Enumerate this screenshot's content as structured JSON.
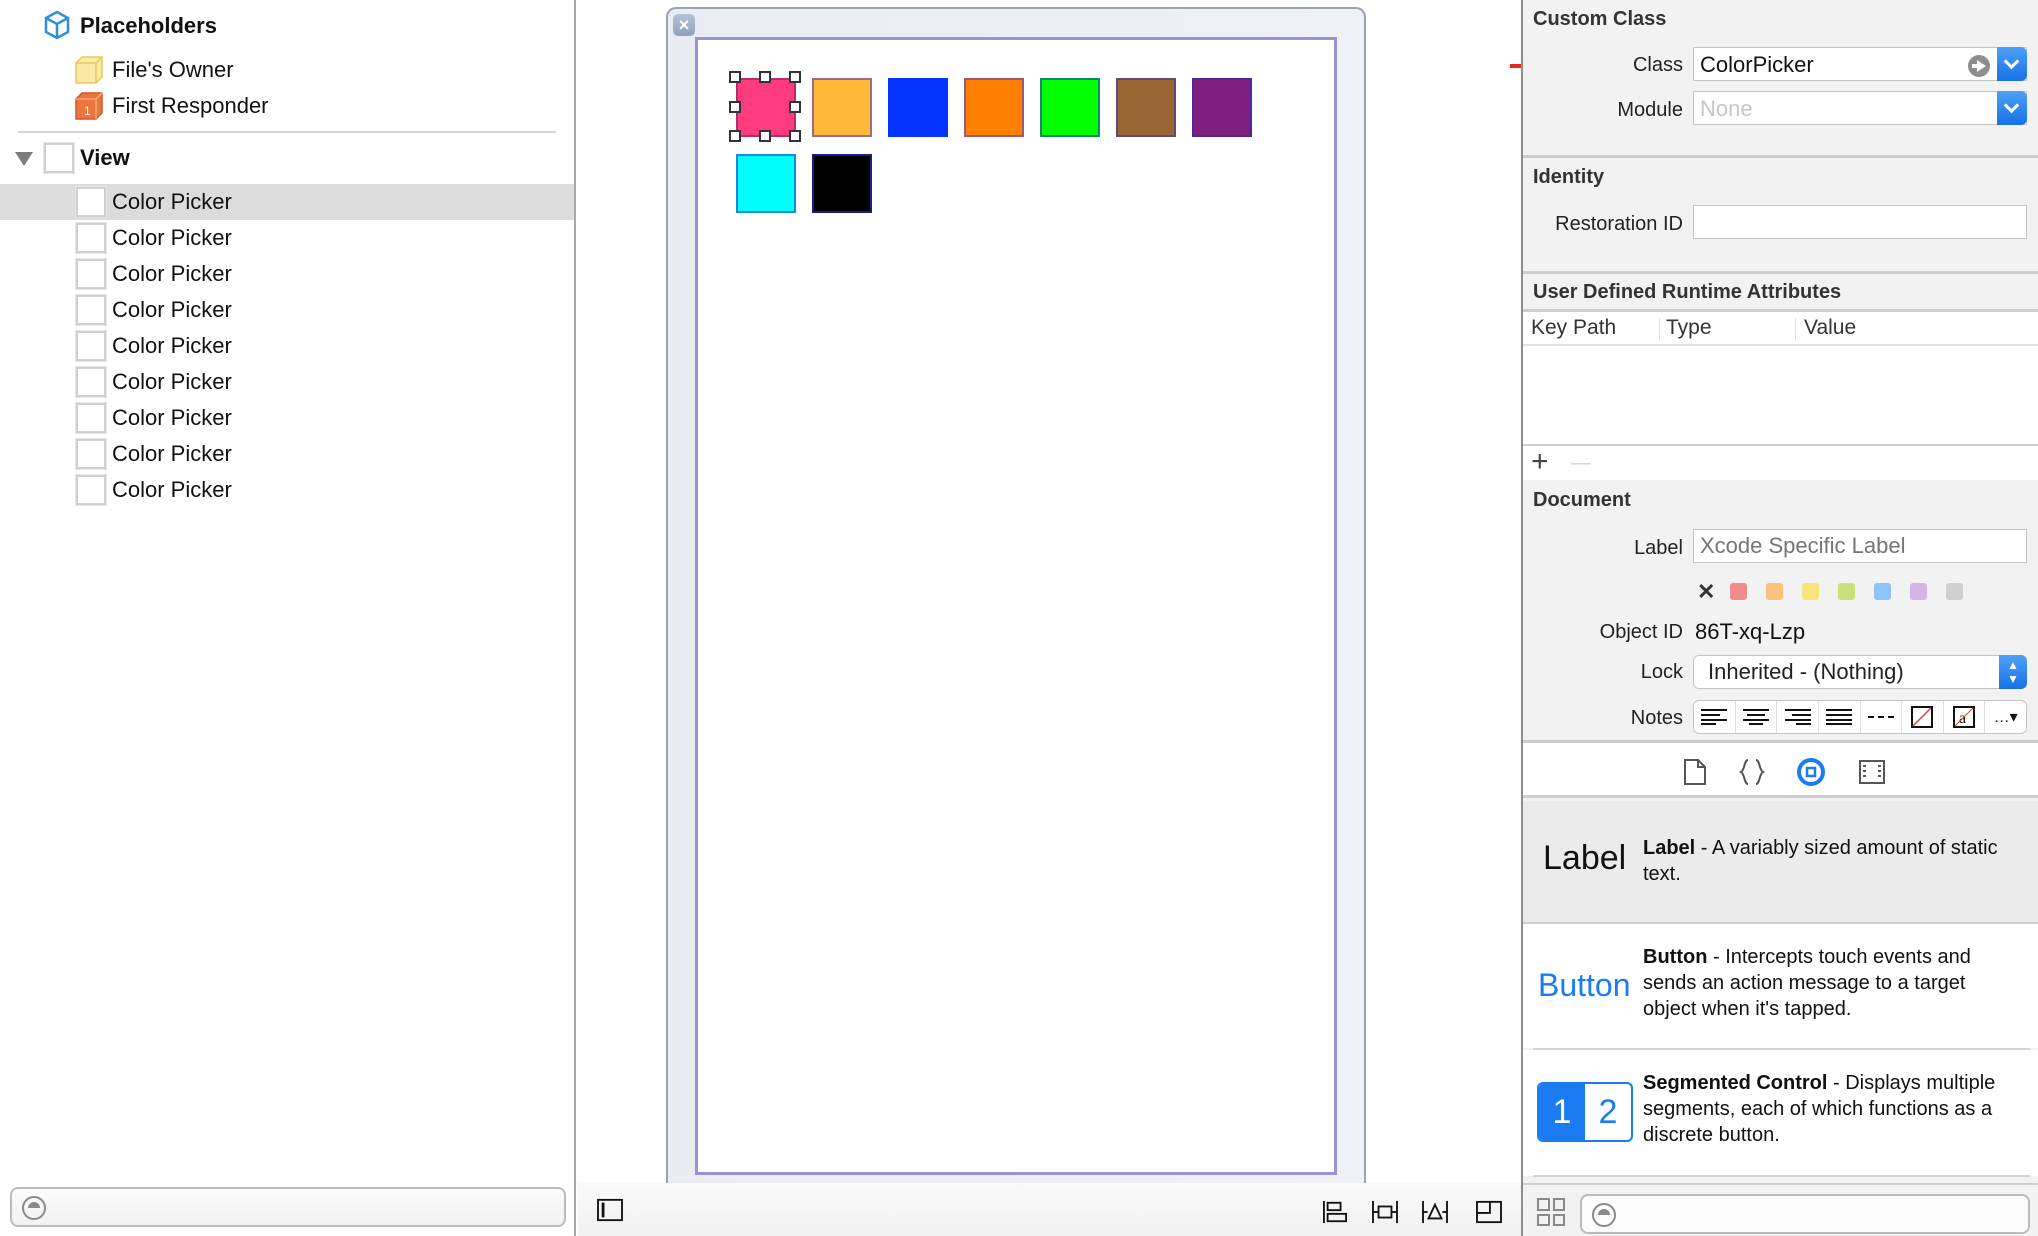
{
  "outline": {
    "placeholders_label": "Placeholders",
    "placeholder_items": [
      {
        "label": "File's Owner",
        "icon": "files-owner-cube-icon"
      },
      {
        "label": "First Responder",
        "icon": "first-responder-cube-icon"
      }
    ],
    "view_label": "View",
    "view_children": [
      {
        "label": "Color Picker",
        "selected": true
      },
      {
        "label": "Color Picker",
        "selected": false
      },
      {
        "label": "Color Picker",
        "selected": false
      },
      {
        "label": "Color Picker",
        "selected": false
      },
      {
        "label": "Color Picker",
        "selected": false
      },
      {
        "label": "Color Picker",
        "selected": false
      },
      {
        "label": "Color Picker",
        "selected": false
      },
      {
        "label": "Color Picker",
        "selected": false
      },
      {
        "label": "Color Picker",
        "selected": false
      }
    ],
    "filter_placeholder": ""
  },
  "canvas": {
    "swatches": [
      {
        "name": "pink",
        "fill": "#ff3b80",
        "border": "#b0306e",
        "selected": true
      },
      {
        "name": "yellow-orange",
        "fill": "#ffb83a",
        "border": "#9a6e88"
      },
      {
        "name": "blue",
        "fill": "#0433ff",
        "border": "#0433ff"
      },
      {
        "name": "orange",
        "fill": "#ff7f00",
        "border": "#9a5a78"
      },
      {
        "name": "green",
        "fill": "#00ff00",
        "border": "#13866c"
      },
      {
        "name": "brown",
        "fill": "#996633",
        "border": "#5e4a7a"
      },
      {
        "name": "purple",
        "fill": "#7f1f7f",
        "border": "#4a2a9a"
      },
      {
        "name": "cyan",
        "fill": "#00ffff",
        "border": "#1a8ae0"
      },
      {
        "name": "black",
        "fill": "#000000",
        "border": "#1b1b8a"
      }
    ],
    "toolbar_icons": [
      "toggle-outline-icon",
      "align-icon",
      "pin-icon",
      "resolve-issues-icon",
      "resizing-behavior-icon"
    ]
  },
  "inspector": {
    "custom_class": {
      "title": "Custom Class",
      "class_label": "Class",
      "class_value": "ColorPicker",
      "module_label": "Module",
      "module_placeholder": "None"
    },
    "identity": {
      "title": "Identity",
      "restoration_id_label": "Restoration ID",
      "restoration_id_value": ""
    },
    "udra": {
      "title": "User Defined Runtime Attributes",
      "columns": [
        "Key Path",
        "Type",
        "Value"
      ],
      "rows": [],
      "add_label": "+",
      "remove_label": "—"
    },
    "document": {
      "title": "Document",
      "label_label": "Label",
      "label_placeholder": "Xcode Specific Label",
      "clear_color_label": "✕",
      "label_colors": [
        "#f28b8b",
        "#f7c27a",
        "#f5e57a",
        "#c8e07a",
        "#8cc4f7",
        "#d7b3ec",
        "#cfcfcf"
      ],
      "object_id_label": "Object ID",
      "object_id_value": "86T-xq-Lzp",
      "lock_label": "Lock",
      "lock_value": "Inherited - (Nothing)",
      "notes_label": "Notes",
      "notes_tools": [
        "align-left",
        "align-center",
        "align-right",
        "justify",
        "---",
        "no-color",
        "font",
        "more"
      ]
    },
    "library_tabs": [
      {
        "name": "file-template-icon",
        "active": false
      },
      {
        "name": "code-snippet-icon",
        "active": false
      },
      {
        "name": "object-library-icon",
        "active": true
      },
      {
        "name": "media-library-icon",
        "active": false
      }
    ],
    "library_items": [
      {
        "preview": "Label",
        "title": "Label",
        "description": " - A variably sized amount of static text."
      },
      {
        "preview": "Button",
        "title": "Button",
        "description": " - Intercepts touch events and sends an action message to a target object when it's tapped."
      },
      {
        "preview_segments": [
          "1",
          "2"
        ],
        "title": "Segmented Control",
        "description": " - Displays multiple segments, each of which functions as a discrete button."
      }
    ],
    "filter_placeholder": ""
  },
  "colors": {
    "accent_blue": "#1a7cf0",
    "annotation_arrow": "#e8281c",
    "view_border": "#9a92d6"
  }
}
